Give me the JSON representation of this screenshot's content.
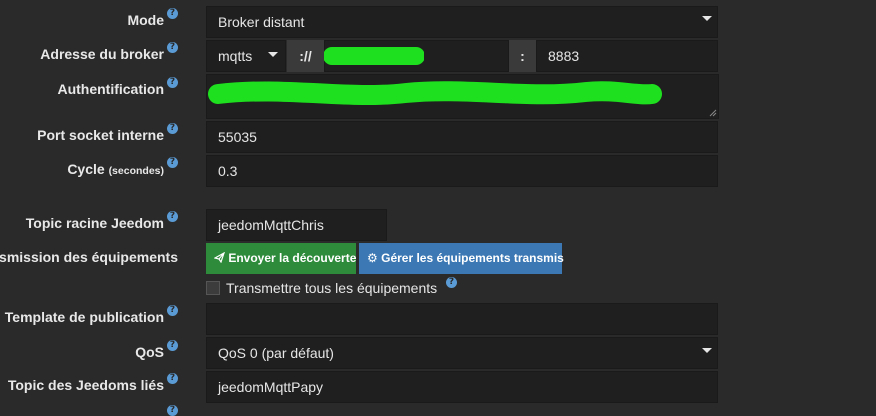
{
  "mode": {
    "label": "Mode",
    "value": "Broker distant"
  },
  "broker": {
    "label": "Adresse du broker",
    "protocol": "mqtts",
    "separator": "://",
    "port_separator": ":",
    "port": "8883"
  },
  "auth": {
    "label": "Authentification"
  },
  "socket": {
    "label": "Port socket interne",
    "value": "55035"
  },
  "cycle": {
    "label": "Cycle",
    "unit": "(secondes)",
    "value": "0.3"
  },
  "topic_root": {
    "label": "Topic racine Jeedom",
    "value": "jeedomMqttChris"
  },
  "transmission": {
    "label": "ansmission des équipements",
    "send_button": "Envoyer la découverte",
    "manage_button": "Gérer les équipements transmis",
    "send_color": "#2e8b3c",
    "manage_color": "#3b78b4"
  },
  "transmit_all": {
    "label": "Transmettre tous les équipements",
    "checked": false
  },
  "template": {
    "label": "Template de publication",
    "value": ""
  },
  "qos": {
    "label": "QoS",
    "value": "QoS 0 (par défaut)"
  },
  "linked_topic": {
    "label": "Topic des Jeedoms liés",
    "value": "jeedomMqttPapy"
  },
  "help_glyph": "?",
  "colors": {
    "background": "#2a2a2a",
    "field": "#1f1f1f",
    "redaction": "#1ee01e"
  }
}
